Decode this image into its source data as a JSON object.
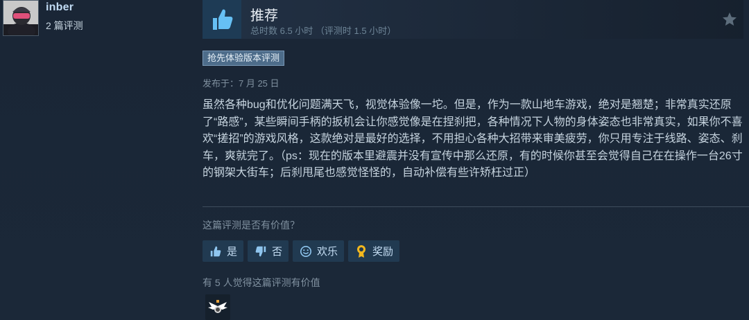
{
  "reviewer": {
    "name": "inber",
    "review_count": "2 篇评测"
  },
  "review": {
    "verdict": "推荐",
    "hours": "总时数 6.5 小时 （评测时 1.5 小时）",
    "early_access_badge": "抢先体验版本评测",
    "posted": "发布于：7 月 25 日",
    "body": "虽然各种bug和优化问题满天飞，视觉体验像一坨。但是，作为一款山地车游戏，绝对是翘楚；非常真实还原了“路感”，某些瞬间手柄的扳机会让你感觉像是在捏刹把，各种情况下人物的身体姿态也非常真实，如果你不喜欢“搓招”的游戏风格，这款绝对是最好的选择，不用担心各种大招带来审美疲劳，你只用专注于线路、姿态、刹车，爽就完了。（ps：现在的版本里避震并没有宣传中那么还原，有的时候你甚至会觉得自己在在操作一台26寸的钢架大街车；后刹甩尾也感觉怪怪的，自动补偿有些许矫枉过正）"
  },
  "feedback": {
    "question": "这篇评测是否有价值？",
    "buttons": {
      "yes": "是",
      "no": "否",
      "funny": "欢乐",
      "award": "奖励"
    },
    "helpful_count_text": "有 5 人觉得这篇评测有价值"
  },
  "icons": {
    "verdict": "thumbs-up-icon",
    "star": "star-icon",
    "yes": "thumbs-up-icon",
    "no": "thumbs-down-icon",
    "funny": "smiley-icon",
    "award": "award-medal-icon",
    "received_award": "winged-award-icon"
  },
  "colors": {
    "background": "#1b2838",
    "accent": "#67c1f5",
    "badge": "#4d6c8a"
  }
}
